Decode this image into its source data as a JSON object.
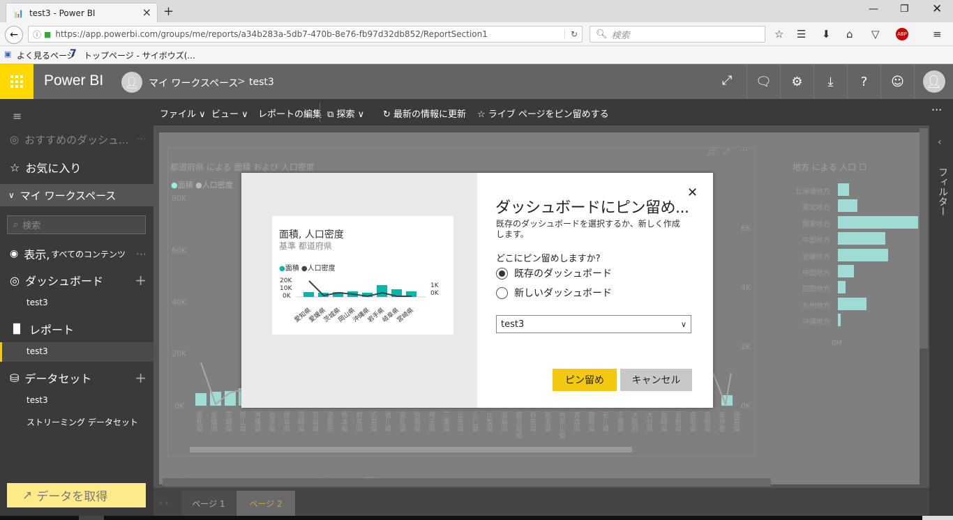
{
  "browser": {
    "tab_title": "test3 - Power BI",
    "url": "https://app.powerbi.com/groups/me/reports/a34b283a-5db7-470b-8e76-fb97d32db852/ReportSection1",
    "search_placeholder": "検索",
    "bookmarks": [
      "よく見るページ",
      "トップページ - サイボウズ(..."
    ]
  },
  "header": {
    "app_name": "Power BI",
    "breadcrumb_workspace": "マイ ワークスペース",
    "breadcrumb_sep": ">",
    "breadcrumb_report": "test3"
  },
  "sidebar": {
    "recommended": "おすすめのダッシュ...",
    "favorites": "お気に入り",
    "workspace": "マイ ワークスペース",
    "search_placeholder": "検索",
    "view_label": "表示,",
    "view_sub": "すべてのコンテンツ",
    "dashboards": "ダッシュボード",
    "dashboards_item": "test3",
    "reports": "レポート",
    "reports_item": "test3",
    "datasets": "データセット",
    "datasets_item1": "test3",
    "datasets_item2": "ストリーミング データセット",
    "get_data": "データを取得"
  },
  "toolbar": {
    "file": "ファイル",
    "view": "ビュー",
    "edit": "レポートの編集",
    "explore": "探索",
    "refresh": "最新の情報に更新",
    "pin_live": "ライブ ページをピン留めする"
  },
  "report": {
    "chart_title": "都道府県 による 面積 および 人口密度",
    "legend_area": "面積",
    "legend_density": "人口密度",
    "y_left": [
      "80K",
      "60K",
      "40K",
      "20K",
      "0K"
    ],
    "y_right": [
      "6K",
      "4K",
      "2K",
      "0K"
    ],
    "prefectures": [
      "愛知県",
      "愛媛県",
      "茨城県",
      "岡山県",
      "沖縄県",
      "岩手県",
      "岐阜県",
      "宮崎県",
      "宮城県",
      "京都府",
      "熊本県",
      "群馬県",
      "広島県",
      "香川県",
      "高知県",
      "佐賀県",
      "埼玉県",
      "三重県",
      "山形県",
      "山口県",
      "山梨県",
      "滋賀県",
      "鹿児島県",
      "秋田県",
      "新潟県",
      "神奈川県",
      "青森県",
      "静岡県",
      "石川県",
      "千葉県",
      "大阪府",
      "大分県",
      "長崎県",
      "長野県",
      "鳥取県",
      "島根県",
      "東京都",
      "徳島県"
    ],
    "region_chart_title": "地方 による 人口",
    "regions": [
      "北海道地方",
      "東北地方",
      "関東地方",
      "中部地方",
      "近畿地方",
      "中国地方",
      "四国地方",
      "九州地方",
      "沖縄地方"
    ],
    "region_axis": "0M",
    "bottom_labels": [
      "地方",
      "地方",
      "面積"
    ]
  },
  "pages": [
    "ページ 1",
    "ページ 2"
  ],
  "filter_label": "フィルター",
  "dialog": {
    "title": "ダッシュボードにピン留め...",
    "subtitle": "既存のダッシュボードを選択するか、新しく作成します。",
    "question": "どこにピン留めしますか?",
    "option_existing": "既存のダッシュボード",
    "option_new": "新しいダッシュボード",
    "selected_dashboard": "test3",
    "pin_button": "ピン留め",
    "cancel_button": "キャンセル",
    "preview_title": "面積, 人口密度",
    "preview_subtitle": "基準 都道府県",
    "preview_legend_area": "面積",
    "preview_legend_density": "人口密度",
    "preview_y_left": [
      "20K",
      "10K",
      "0K"
    ],
    "preview_y_right": [
      "1K",
      "0K"
    ],
    "preview_x": [
      "愛知県",
      "愛媛県",
      "茨城県",
      "岡山県",
      "沖縄県",
      "岩手県",
      "岐阜県",
      "宮崎県"
    ]
  },
  "colors": {
    "accent_yellow": "#f2c811",
    "teal": "#01b8aa",
    "dark_series": "#374649",
    "header_gray": "#646464"
  }
}
